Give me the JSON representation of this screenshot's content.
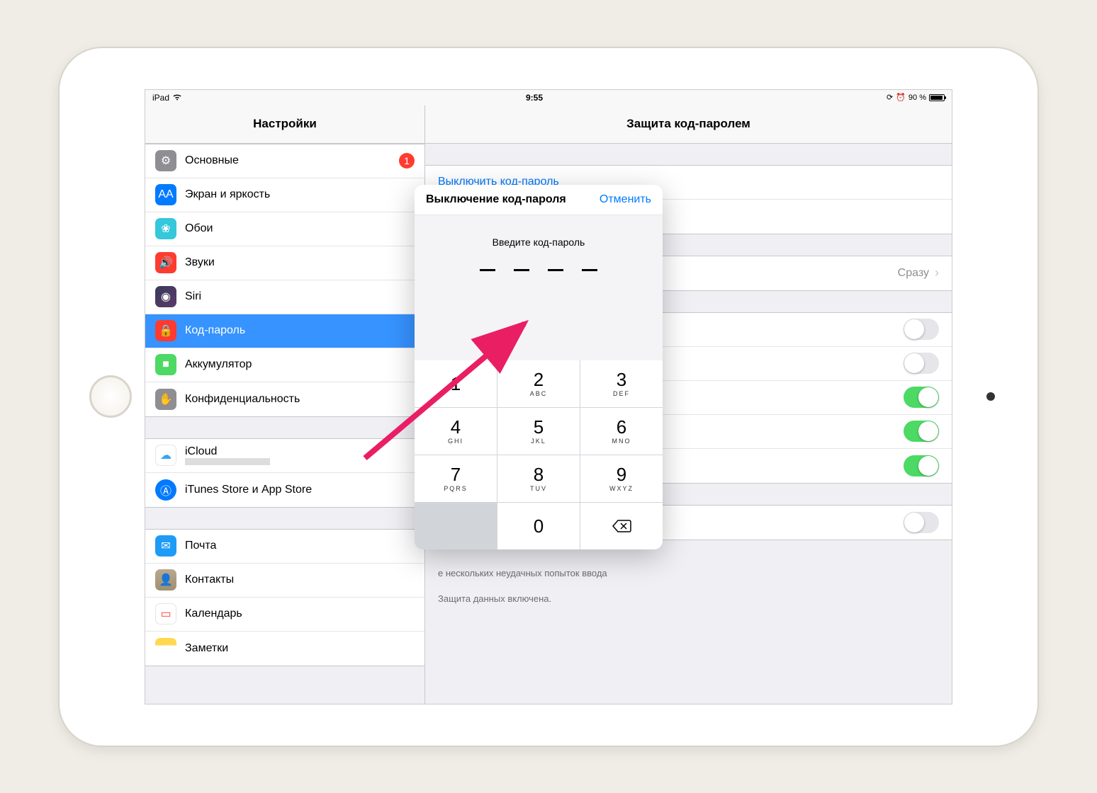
{
  "status": {
    "device": "iPad",
    "time": "9:55",
    "battery_pct": "90 %",
    "orientation_lock": "⊕",
    "alarm": "⏰"
  },
  "sidebar": {
    "title": "Настройки",
    "groups": [
      [
        {
          "label": "Основные",
          "badge": "1",
          "icon": "general"
        },
        {
          "label": "Экран и яркость",
          "icon": "display"
        },
        {
          "label": "Обои",
          "icon": "wallpaper"
        },
        {
          "label": "Звуки",
          "icon": "sounds"
        },
        {
          "label": "Siri",
          "icon": "siri"
        },
        {
          "label": "Код-пароль",
          "icon": "lock",
          "selected": true
        },
        {
          "label": "Аккумулятор",
          "icon": "battery"
        },
        {
          "label": "Конфиденциальность",
          "icon": "privacy"
        }
      ],
      [
        {
          "label": "iCloud",
          "sub": "",
          "icon": "icloud"
        },
        {
          "label": "iTunes Store и App Store",
          "icon": "itunes"
        }
      ],
      [
        {
          "label": "Почта",
          "icon": "mail"
        },
        {
          "label": "Контакты",
          "icon": "contacts"
        },
        {
          "label": "Календарь",
          "icon": "calendar"
        },
        {
          "label": "Заметки",
          "icon": "notes"
        }
      ]
    ]
  },
  "detail": {
    "title": "Защита код-паролем",
    "turn_off_link": "Выключить код-пароль",
    "require": {
      "label": "",
      "value": "Сразу"
    },
    "toggles": [
      false,
      false,
      true,
      true,
      true,
      false
    ],
    "erase_footer1": "е нескольких неудачных попыток ввода",
    "erase_footer2": "Защита данных включена."
  },
  "modal": {
    "title": "Выключение код-пароля",
    "cancel": "Отменить",
    "prompt": "Введите код-пароль",
    "keys": [
      {
        "d": "1",
        "l": ""
      },
      {
        "d": "2",
        "l": "ABC"
      },
      {
        "d": "3",
        "l": "DEF"
      },
      {
        "d": "4",
        "l": "GHI"
      },
      {
        "d": "5",
        "l": "JKL"
      },
      {
        "d": "6",
        "l": "MNO"
      },
      {
        "d": "7",
        "l": "PQRS"
      },
      {
        "d": "8",
        "l": "TUV"
      },
      {
        "d": "9",
        "l": "WXYZ"
      },
      {
        "blank": true
      },
      {
        "d": "0",
        "l": ""
      },
      {
        "backspace": true
      }
    ]
  }
}
